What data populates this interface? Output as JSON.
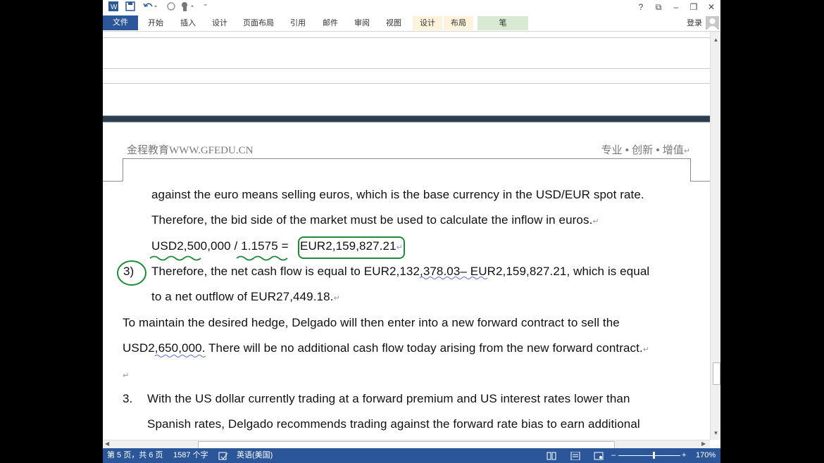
{
  "titlebar": {
    "icons": [
      "word-icon",
      "save-icon",
      "undo-icon",
      "redo-icon",
      "touch-mode-icon",
      "customize-qat-icon"
    ],
    "help": "?",
    "restore_ribbon": "⧉",
    "minimize": "–",
    "maximize": "❐",
    "close": "✕"
  },
  "ribbon": {
    "tabs": [
      "文件",
      "开始",
      "插入",
      "设计",
      "页面布局",
      "引用",
      "邮件",
      "审阅",
      "视图",
      "设计",
      "布局",
      "笔"
    ],
    "login": "登录"
  },
  "document": {
    "header_left": "金程教育WWW.GFEDU.CN",
    "header_right": "专业 • 创新 • 增值",
    "lines": [
      "against the euro means selling euros, which is the base currency in the USD/EUR spot rate.",
      "Therefore, the bid side of the market must be used to calculate the inflow in euros.",
      "USD2,500,000 / 1.1575 = ",
      "EUR2,159,827.21",
      "3)",
      "Therefore, the net cash flow is equal to EUR2,132,378.03– EUR2,159,827.21, which is equal",
      "to a net outflow of EUR27,449.18.",
      "To maintain the desired hedge, Delgado will then enter into a new forward contract to sell the",
      "USD2,650,000. There will be no additional cash flow today arising from the new forward contract.",
      "3.",
      "With the US dollar currently trading at a forward premium and US interest rates lower than",
      "Spanish rates, Delgado recommends trading against the forward rate bias to earn additional"
    ],
    "paragraph_mark": "↵",
    "annotation_color": "#1f8a3a",
    "spell_color": "#5b6fd6"
  },
  "statusbar": {
    "page": "第 5 页，共 6 页",
    "words": "1587 个字",
    "language": "英语(美国)",
    "zoom": "170%",
    "zoom_minus": "–",
    "zoom_plus": "+"
  },
  "colors": {
    "brand": "#2b579a"
  }
}
